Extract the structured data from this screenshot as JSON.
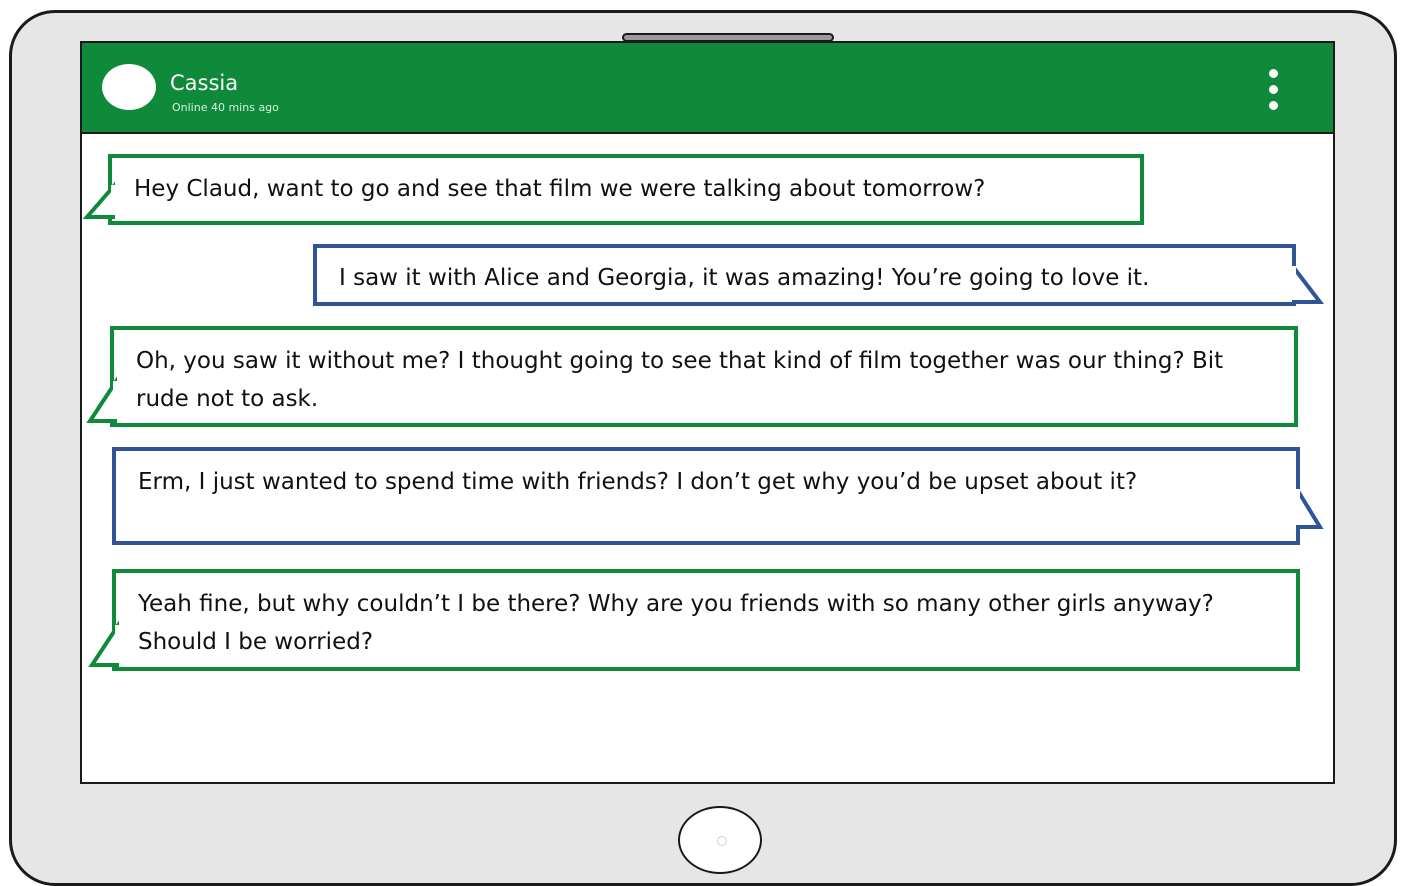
{
  "contact": {
    "name": "Cassia",
    "status": "Online 40 mins ago"
  },
  "colors": {
    "header": "#0e8a3a",
    "incoming_border": "#0e8a3a",
    "outgoing_border": "#2f5597",
    "device_body": "#e6e6e6"
  },
  "icons": {
    "menu": "more-vertical-icon"
  },
  "messages": [
    {
      "sender": "contact",
      "text": "Hey Claud, want to go and see that film we were talking about tomorrow?"
    },
    {
      "sender": "self",
      "text": "I saw it with Alice and Georgia, it was amazing! You’re going to love it."
    },
    {
      "sender": "contact",
      "text": "Oh, you saw it without me? I thought going to see that kind of film together was our thing? Bit rude not to ask."
    },
    {
      "sender": "self",
      "text": "Erm, I just wanted to spend time with friends? I don’t get why you’d be upset about it?"
    },
    {
      "sender": "contact",
      "text": "Yeah fine, but why couldn’t I be there? Why are you friends with so many other girls anyway? Should I be worried?"
    }
  ]
}
